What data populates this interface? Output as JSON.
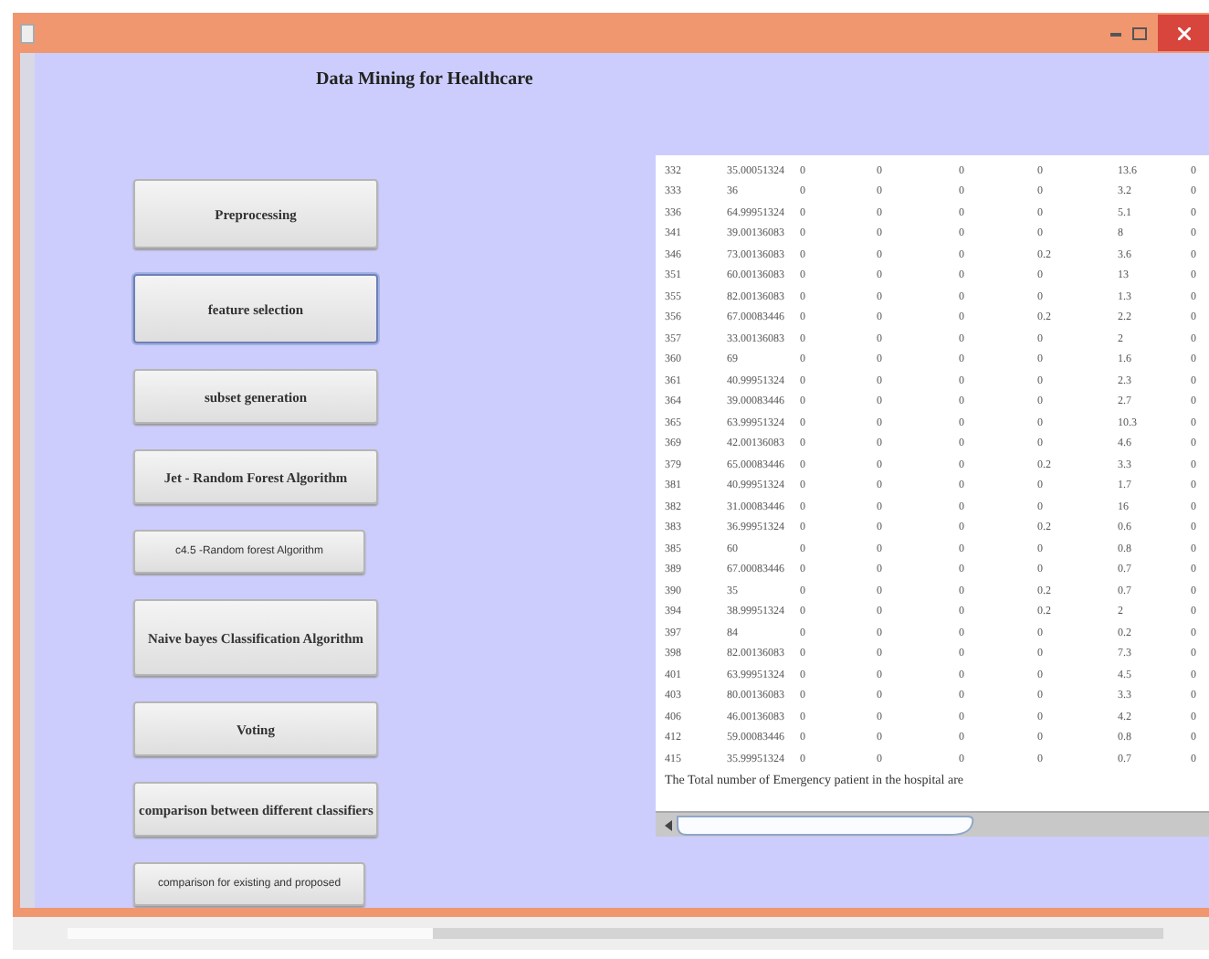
{
  "window": {
    "title": "Data Mining for Healthcare"
  },
  "buttons": [
    {
      "label": "Preprocessing",
      "kind": "large",
      "focused": false
    },
    {
      "label": "feature selection",
      "kind": "large",
      "focused": true
    },
    {
      "label": "subset generation",
      "kind": "medium",
      "focused": false
    },
    {
      "label": "Jet - Random Forest Algorithm",
      "kind": "medium",
      "focused": false
    },
    {
      "label": "c4.5 -Random forest Algorithm",
      "kind": "small",
      "focused": false
    },
    {
      "label": "Naive bayes Classification Algorithm",
      "kind": "tall",
      "focused": false
    },
    {
      "label": "Voting",
      "kind": "medium",
      "focused": false
    },
    {
      "label": "comparison between different classifiers",
      "kind": "medium",
      "focused": false
    },
    {
      "label": "comparison for existing and proposed",
      "kind": "small",
      "focused": false
    }
  ],
  "table": {
    "rows": [
      [
        "332",
        "35.00051324",
        "0",
        "0",
        "0",
        "0",
        "13.6",
        "0"
      ],
      [
        "333",
        "36",
        "0",
        "0",
        "0",
        "0",
        "3.2",
        "0"
      ],
      [
        "336",
        "64.99951324",
        "0",
        "0",
        "0",
        "0",
        "5.1",
        "0"
      ],
      [
        "341",
        "39.00136083",
        "0",
        "0",
        "0",
        "0",
        "8",
        "0"
      ],
      [
        "346",
        "73.00136083",
        "0",
        "0",
        "0",
        "0.2",
        "3.6",
        "0"
      ],
      [
        "351",
        "60.00136083",
        "0",
        "0",
        "0",
        "0",
        "13",
        "0"
      ],
      [
        "355",
        "82.00136083",
        "0",
        "0",
        "0",
        "0",
        "1.3",
        "0"
      ],
      [
        "356",
        "67.00083446",
        "0",
        "0",
        "0",
        "0.2",
        "2.2",
        "0"
      ],
      [
        "357",
        "33.00136083",
        "0",
        "0",
        "0",
        "0",
        "2",
        "0"
      ],
      [
        "360",
        "69",
        "0",
        "0",
        "0",
        "0",
        "1.6",
        "0"
      ],
      [
        "361",
        "40.99951324",
        "0",
        "0",
        "0",
        "0",
        "2.3",
        "0"
      ],
      [
        "364",
        "39.00083446",
        "0",
        "0",
        "0",
        "0",
        "2.7",
        "0"
      ],
      [
        "365",
        "63.99951324",
        "0",
        "0",
        "0",
        "0",
        "10.3",
        "0"
      ],
      [
        "369",
        "42.00136083",
        "0",
        "0",
        "0",
        "0",
        "4.6",
        "0"
      ],
      [
        "379",
        "65.00083446",
        "0",
        "0",
        "0",
        "0.2",
        "3.3",
        "0"
      ],
      [
        "381",
        "40.99951324",
        "0",
        "0",
        "0",
        "0",
        "1.7",
        "0"
      ],
      [
        "382",
        "31.00083446",
        "0",
        "0",
        "0",
        "0",
        "16",
        "0"
      ],
      [
        "383",
        "36.99951324",
        "0",
        "0",
        "0",
        "0.2",
        "0.6",
        "0"
      ],
      [
        "385",
        "60",
        "0",
        "0",
        "0",
        "0",
        "0.8",
        "0"
      ],
      [
        "389",
        "67.00083446",
        "0",
        "0",
        "0",
        "0",
        "0.7",
        "0"
      ],
      [
        "390",
        "35",
        "0",
        "0",
        "0",
        "0.2",
        "0.7",
        "0"
      ],
      [
        "394",
        "38.99951324",
        "0",
        "0",
        "0",
        "0.2",
        "2",
        "0"
      ],
      [
        "397",
        "84",
        "0",
        "0",
        "0",
        "0",
        "0.2",
        "0"
      ],
      [
        "398",
        "82.00136083",
        "0",
        "0",
        "0",
        "0",
        "7.3",
        "0"
      ],
      [
        "401",
        "63.99951324",
        "0",
        "0",
        "0",
        "0",
        "4.5",
        "0"
      ],
      [
        "403",
        "80.00136083",
        "0",
        "0",
        "0",
        "0",
        "3.3",
        "0"
      ],
      [
        "406",
        "46.00136083",
        "0",
        "0",
        "0",
        "0",
        "4.2",
        "0"
      ],
      [
        "412",
        "59.00083446",
        "0",
        "0",
        "0",
        "0",
        "0.8",
        "0"
      ],
      [
        "415",
        "35.99951324",
        "0",
        "0",
        "0",
        "0",
        "0.7",
        "0"
      ]
    ],
    "summary": "The Total number of Emergency patient in the hospital are"
  }
}
